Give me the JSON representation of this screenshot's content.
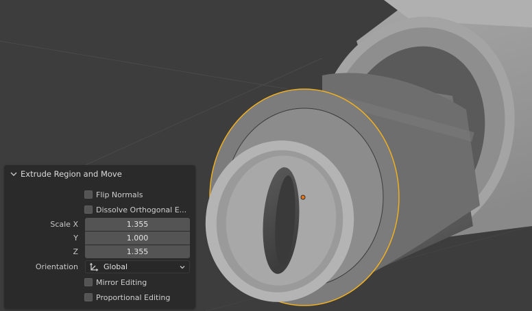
{
  "panel": {
    "title": "Extrude Region and Move",
    "flip_normals": {
      "label": "Flip Normals",
      "checked": false
    },
    "dissolve_orthogonal": {
      "label": "Dissolve Orthogonal E...",
      "checked": false
    },
    "scale": {
      "label_x": "Scale X",
      "label_y": "Y",
      "label_z": "Z",
      "x": "1.355",
      "y": "1.000",
      "z": "1.355"
    },
    "orientation": {
      "label": "Orientation",
      "value": "Global"
    },
    "mirror_editing": {
      "label": "Mirror Editing",
      "checked": false
    },
    "proportional_editing": {
      "label": "Proportional Editing",
      "checked": false
    }
  },
  "colors": {
    "viewport_bg": "#3d3d3d",
    "panel_bg": "#2a2a2a",
    "selection_outline": "#f0b020",
    "origin_dot": "#e8781a"
  },
  "icons": [
    "chevron-down-icon",
    "transform-orientation-icon",
    "dropdown-arrow-icon"
  ]
}
